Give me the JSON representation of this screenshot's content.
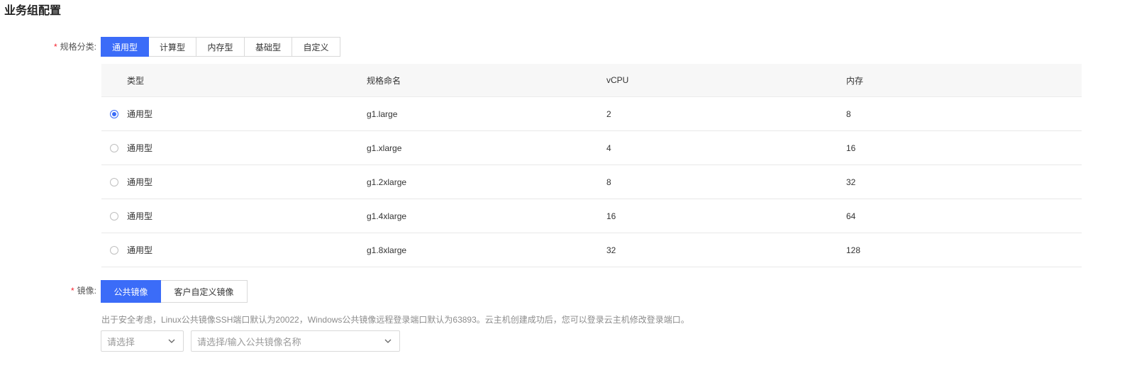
{
  "section_title": "业务组配置",
  "spec": {
    "label": "规格分类:",
    "required_mark": "*",
    "tabs": [
      {
        "label": "通用型",
        "active": true
      },
      {
        "label": "计算型",
        "active": false
      },
      {
        "label": "内存型",
        "active": false
      },
      {
        "label": "基础型",
        "active": false
      },
      {
        "label": "自定义",
        "active": false
      }
    ]
  },
  "table": {
    "columns": [
      "类型",
      "规格命名",
      "vCPU",
      "内存"
    ],
    "rows": [
      {
        "type": "通用型",
        "name": "g1.large",
        "vcpu": "2",
        "memory": "8",
        "selected": true
      },
      {
        "type": "通用型",
        "name": "g1.xlarge",
        "vcpu": "4",
        "memory": "16",
        "selected": false
      },
      {
        "type": "通用型",
        "name": "g1.2xlarge",
        "vcpu": "8",
        "memory": "32",
        "selected": false
      },
      {
        "type": "通用型",
        "name": "g1.4xlarge",
        "vcpu": "16",
        "memory": "64",
        "selected": false
      },
      {
        "type": "通用型",
        "name": "g1.8xlarge",
        "vcpu": "32",
        "memory": "128",
        "selected": false
      }
    ]
  },
  "image": {
    "label": "镜像:",
    "required_mark": "*",
    "tabs": [
      {
        "label": "公共镜像",
        "active": true
      },
      {
        "label": "客户自定义镜像",
        "active": false
      }
    ],
    "hint": "出于安全考虑，Linux公共镜像SSH端口默认为20022，Windows公共镜像远程登录端口默认为63893。云主机创建成功后，您可以登录云主机修改登录端口。",
    "os_select": {
      "placeholder": "请选择"
    },
    "image_select": {
      "placeholder": "请选择/输入公共镜像名称"
    }
  },
  "colors": {
    "accent": "#3b6cf8",
    "required": "#f5222d"
  },
  "icons": {
    "select_arrow": "chevron-down-icon",
    "radio": "radio-icon"
  }
}
